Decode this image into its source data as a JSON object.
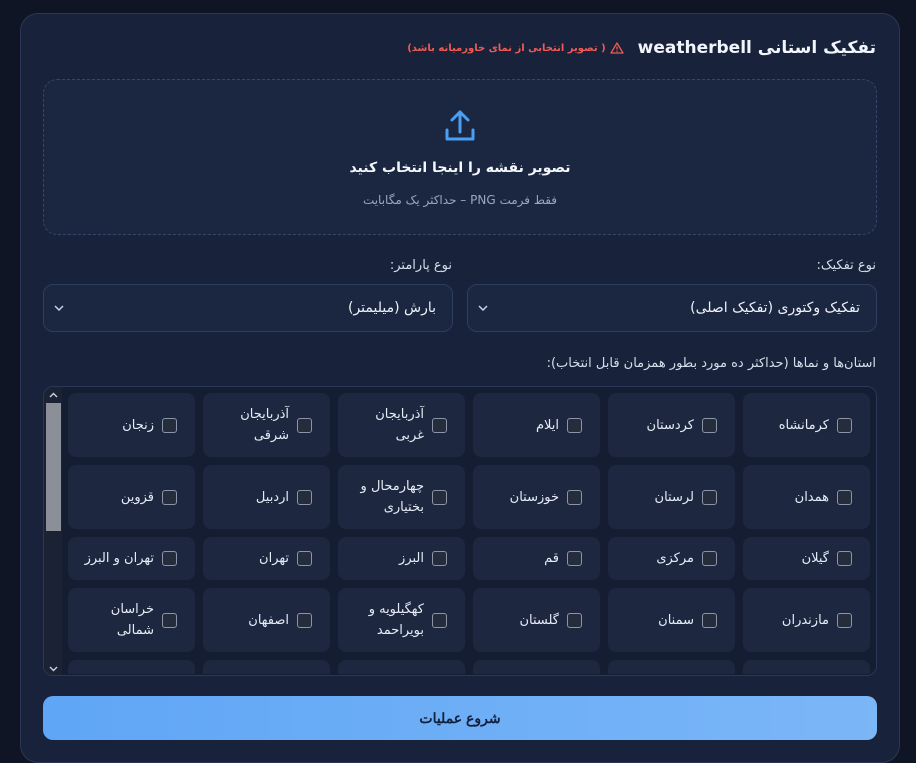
{
  "header": {
    "title": "تفکیک استانی weatherbell",
    "warning": "( تصویر انتخابی از نمای خاورمیانه باشد)"
  },
  "upload": {
    "title": "تصویر نقشه را اینجا انتخاب کنید",
    "subtitle": "فقط فرمت PNG – حداکثر یک مگابایت"
  },
  "split_type": {
    "label": "نوع تفکیک:",
    "value": "تفکیک وکتوری (تفکیک اصلی)"
  },
  "param_type": {
    "label": "نوع پارامتر:",
    "value": "بارش (میلیمتر)"
  },
  "provinces": {
    "label": "استان‌ها و نماها (حداکثر ده مورد بطور همزمان قابل انتخاب):",
    "items": [
      "کرمانشاه",
      "کردستان",
      "ایلام",
      "آذربایجان غربی",
      "آذربایجان شرقی",
      "زنجان",
      "همدان",
      "لرستان",
      "خوزستان",
      "چهارمحال و بختیاری",
      "اردبیل",
      "قزوین",
      "گیلان",
      "مرکزی",
      "قم",
      "البرز",
      "تهران",
      "تهران و البرز",
      "مازندران",
      "سمنان",
      "گلستان",
      "کهگیلویه و بویراحمد",
      "اصفهان",
      "خراسان شمالی"
    ]
  },
  "actions": {
    "start": "شروع عملیات"
  },
  "colors": {
    "background": "#0f1524",
    "panel": "#18223a",
    "warning": "#ef5b55",
    "accent": "#5fa6f6"
  }
}
